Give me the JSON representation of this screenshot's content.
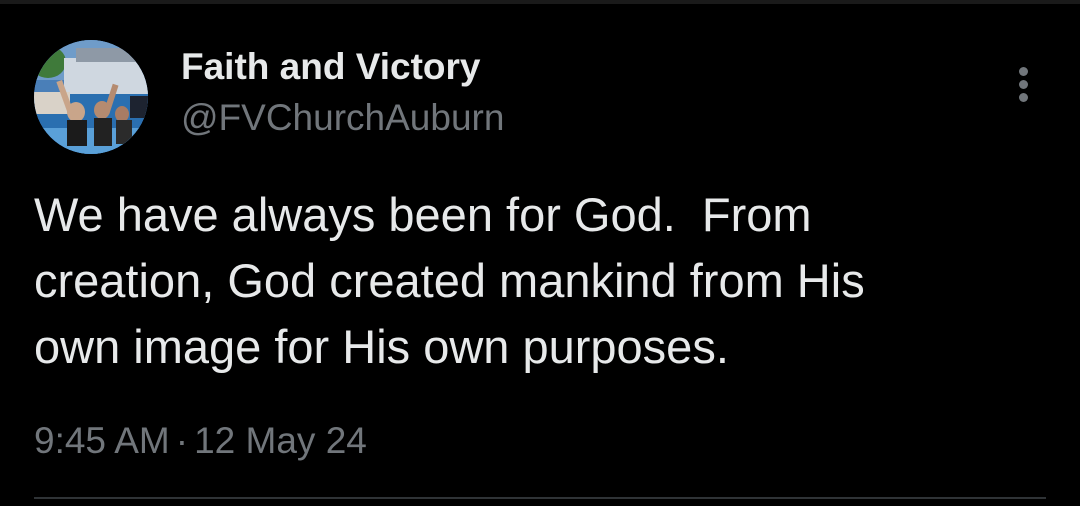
{
  "tweet": {
    "author": {
      "name": "Faith and Victory",
      "handle": "@FVChurchAuburn"
    },
    "text_lines": [
      "We have always been for God.  From",
      "creation, God created mankind from His",
      "own image for His own purposes."
    ],
    "time": "9:45 AM",
    "separator": "·",
    "date": "12 May 24",
    "menu_icon": "more-vertical-icon"
  },
  "colors": {
    "background": "#000000",
    "primary_text": "#e7e9ea",
    "secondary_text": "#71767b",
    "divider": "#2f3336"
  }
}
